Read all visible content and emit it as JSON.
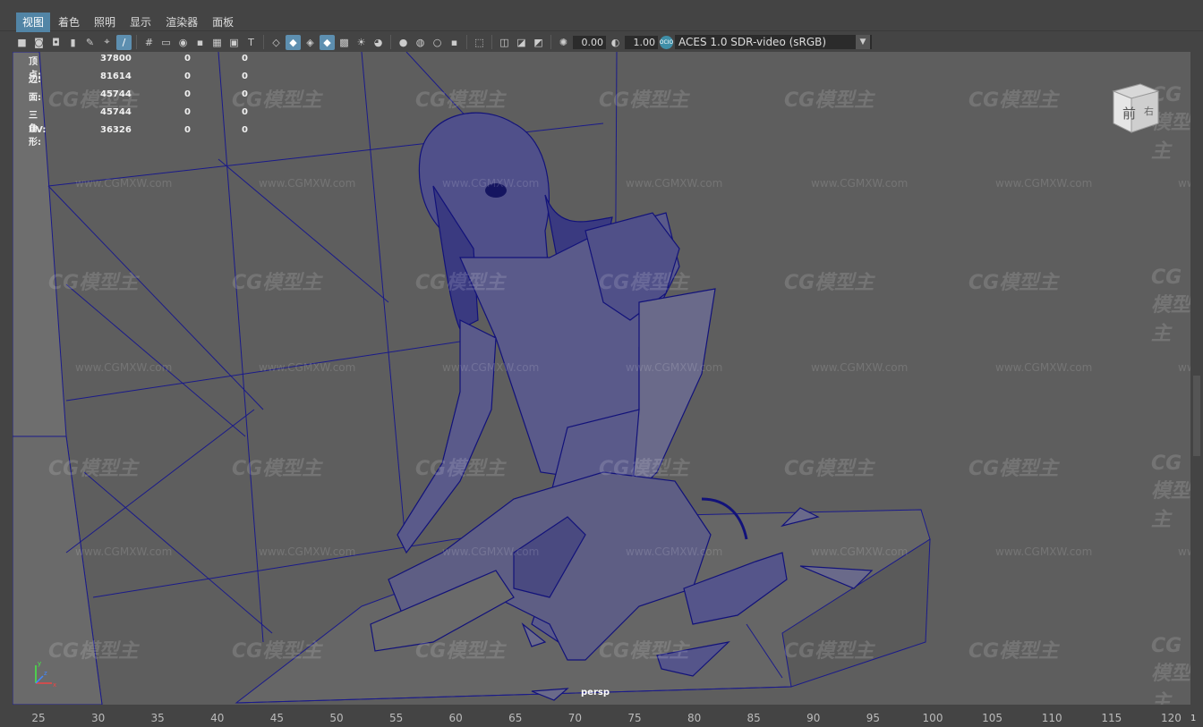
{
  "menu": {
    "items": [
      "视图",
      "着色",
      "照明",
      "显示",
      "渲染器",
      "面板"
    ],
    "active_index": 0
  },
  "toolbar": {
    "exposure_value": "0.00",
    "gamma_value": "1.00",
    "color_space_icon": "ocio-icon",
    "color_space": "ACES 1.0 SDR-video (sRGB)",
    "icons": [
      "camera-icon",
      "camera-attr-icon",
      "bookmark-icon",
      "image-plane-icon",
      "grid-icon",
      "film-gate-icon",
      "resolution-gate-icon",
      "gate-mask-icon",
      "field-chart-icon",
      "safe-action-icon",
      "safe-title-icon",
      "wireframe-icon",
      "smooth-shade-icon",
      "default-material-icon",
      "wireframe-on-shaded-icon",
      "textured-icon",
      "lights-icon",
      "shadows-icon",
      "ssao-icon",
      "motion-blur-icon",
      "multisample-icon",
      "xray-icon",
      "xray-joints-icon",
      "xray-components-icon",
      "isolate-select-icon",
      "exposure-icon",
      "gamma-icon"
    ]
  },
  "stats": {
    "rows": [
      {
        "label": "顶点:",
        "total": "37800",
        "selected": "0",
        "component": "0"
      },
      {
        "label": "边:",
        "total": "81614",
        "selected": "0",
        "component": "0"
      },
      {
        "label": "面:",
        "total": "45744",
        "selected": "0",
        "component": "0"
      },
      {
        "label": "三角形:",
        "total": "45744",
        "selected": "0",
        "component": "0"
      },
      {
        "label": "UV:",
        "total": "36326",
        "selected": "0",
        "component": "0"
      }
    ]
  },
  "viewcube": {
    "front_label": "前",
    "right_label": "右"
  },
  "viewport": {
    "camera": "persp",
    "watermark_logo": "CG模型主",
    "watermark_url": "www.CGMXW.com",
    "axis_labels": [
      "x",
      "y",
      "z"
    ]
  },
  "timeline": {
    "ticks": [
      "25",
      "30",
      "35",
      "40",
      "45",
      "50",
      "55",
      "60",
      "65",
      "70",
      "75",
      "80",
      "85",
      "90",
      "95",
      "100",
      "105",
      "110",
      "115",
      "120"
    ],
    "current_frame": "1"
  },
  "colors": {
    "menu_active": "#5285a6",
    "viewport_bg": "#5e5e5e",
    "wireframe": "#1a1a8a",
    "icon_active": "#5d8fb0"
  }
}
